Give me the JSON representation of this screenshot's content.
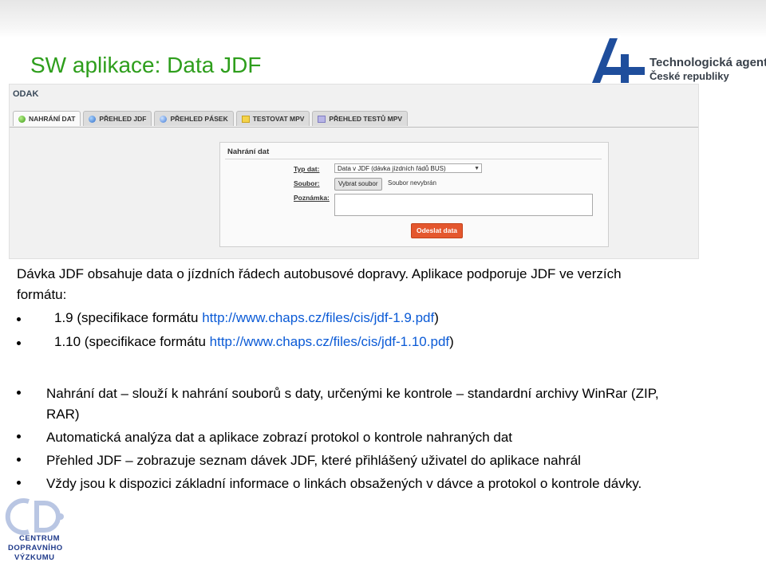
{
  "slide_title": "SW aplikace: Data JDF",
  "logo_tacr": {
    "line1": "Technologická agentura",
    "line2": "České republiky"
  },
  "app": {
    "title": "ODAK",
    "tabs": [
      {
        "label": "NAHRÁNÍ DAT",
        "icon": "green-dot-icon",
        "active": true
      },
      {
        "label": "PŘEHLED JDF",
        "icon": "blue-dot-icon",
        "active": false
      },
      {
        "label": "PŘEHLED PÁSEK",
        "icon": "blue-globe-icon",
        "active": false
      },
      {
        "label": "TESTOVAT MPV",
        "icon": "folder-icon",
        "active": false
      },
      {
        "label": "PŘEHLED TESTŮ MPV",
        "icon": "document-icon",
        "active": false
      }
    ],
    "form": {
      "title": "Nahrání dat",
      "type_label": "Typ dat:",
      "type_value": "Data v JDF (dávka jízdních řádů BUS)",
      "file_label": "Soubor:",
      "file_button": "Vybrat soubor",
      "file_status": "Soubor nevybrán",
      "note_label": "Poznámka:",
      "note_value": "",
      "submit_label": "Odeslat data",
      "submit_color": "#e4572e"
    }
  },
  "intro_text": "Dávka JDF obsahuje data o jízdních řádech autobusové dopravy. Aplikace podporuje JDF ve verzích formátu:",
  "versions": [
    {
      "prefix": "1.9 (specifikace formátu ",
      "link": "http://www.chaps.cz/files/cis/jdf-1.9.pdf",
      "suffix": ")"
    },
    {
      "prefix": "1.10 (specifikace formátu ",
      "link": "http://www.chaps.cz/files/cis/jdf-1.10.pdf",
      "suffix": ")"
    }
  ],
  "features": [
    "Nahrání dat – slouží k nahrání souborů s daty, určenými ke kontrole – standardní archivy WinRar (ZIP, RAR)",
    "Automatická analýza dat a aplikace zobrazí protokol o kontrole nahraných dat",
    "Přehled JDF – zobrazuje seznam dávek JDF, které přihlášený uživatel do aplikace nahrál",
    "Vždy jsou k dispozici základní informace o linkách obsažených v dávce a protokol o kontrole dávky."
  ],
  "logo_cdv": {
    "line1": "CENTRUM",
    "line2": "DOPRAVNÍHO",
    "line3": "VÝZKUMU"
  },
  "colors": {
    "title_green": "#2e9e1c",
    "link_blue": "#0a5ad6",
    "tacr_blue": "#1f4e9c",
    "cdv_blue": "#1f3a8a"
  }
}
